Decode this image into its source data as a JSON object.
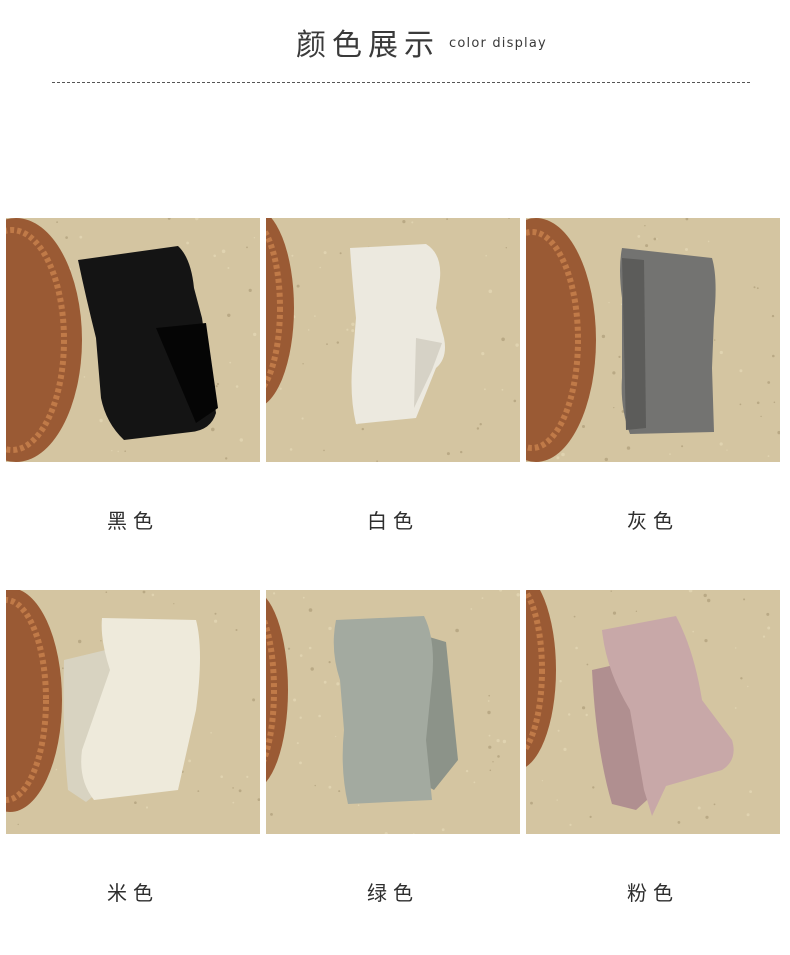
{
  "header": {
    "title_cn": "颜色展示",
    "title_en": "color display"
  },
  "colors": [
    {
      "label": "黑色",
      "sock": "#141414",
      "shade": "#050505"
    },
    {
      "label": "白色",
      "sock": "#ece9df",
      "shade": "#d6d2c6"
    },
    {
      "label": "灰色",
      "sock": "#737371",
      "shade": "#5c5c5a"
    },
    {
      "label": "米色",
      "sock": "#eeeadb",
      "shade": "#d8d3c1"
    },
    {
      "label": "绿色",
      "sock": "#a3aaa0",
      "shade": "#8c9389"
    },
    {
      "label": "粉色",
      "sock": "#c8a8a8",
      "shade": "#b08f90"
    }
  ],
  "palette": {
    "floor": "#d4c5a1",
    "floor_light": "#e0d3b0",
    "basket": "#9a5a34",
    "basket_light": "#c07a48"
  }
}
